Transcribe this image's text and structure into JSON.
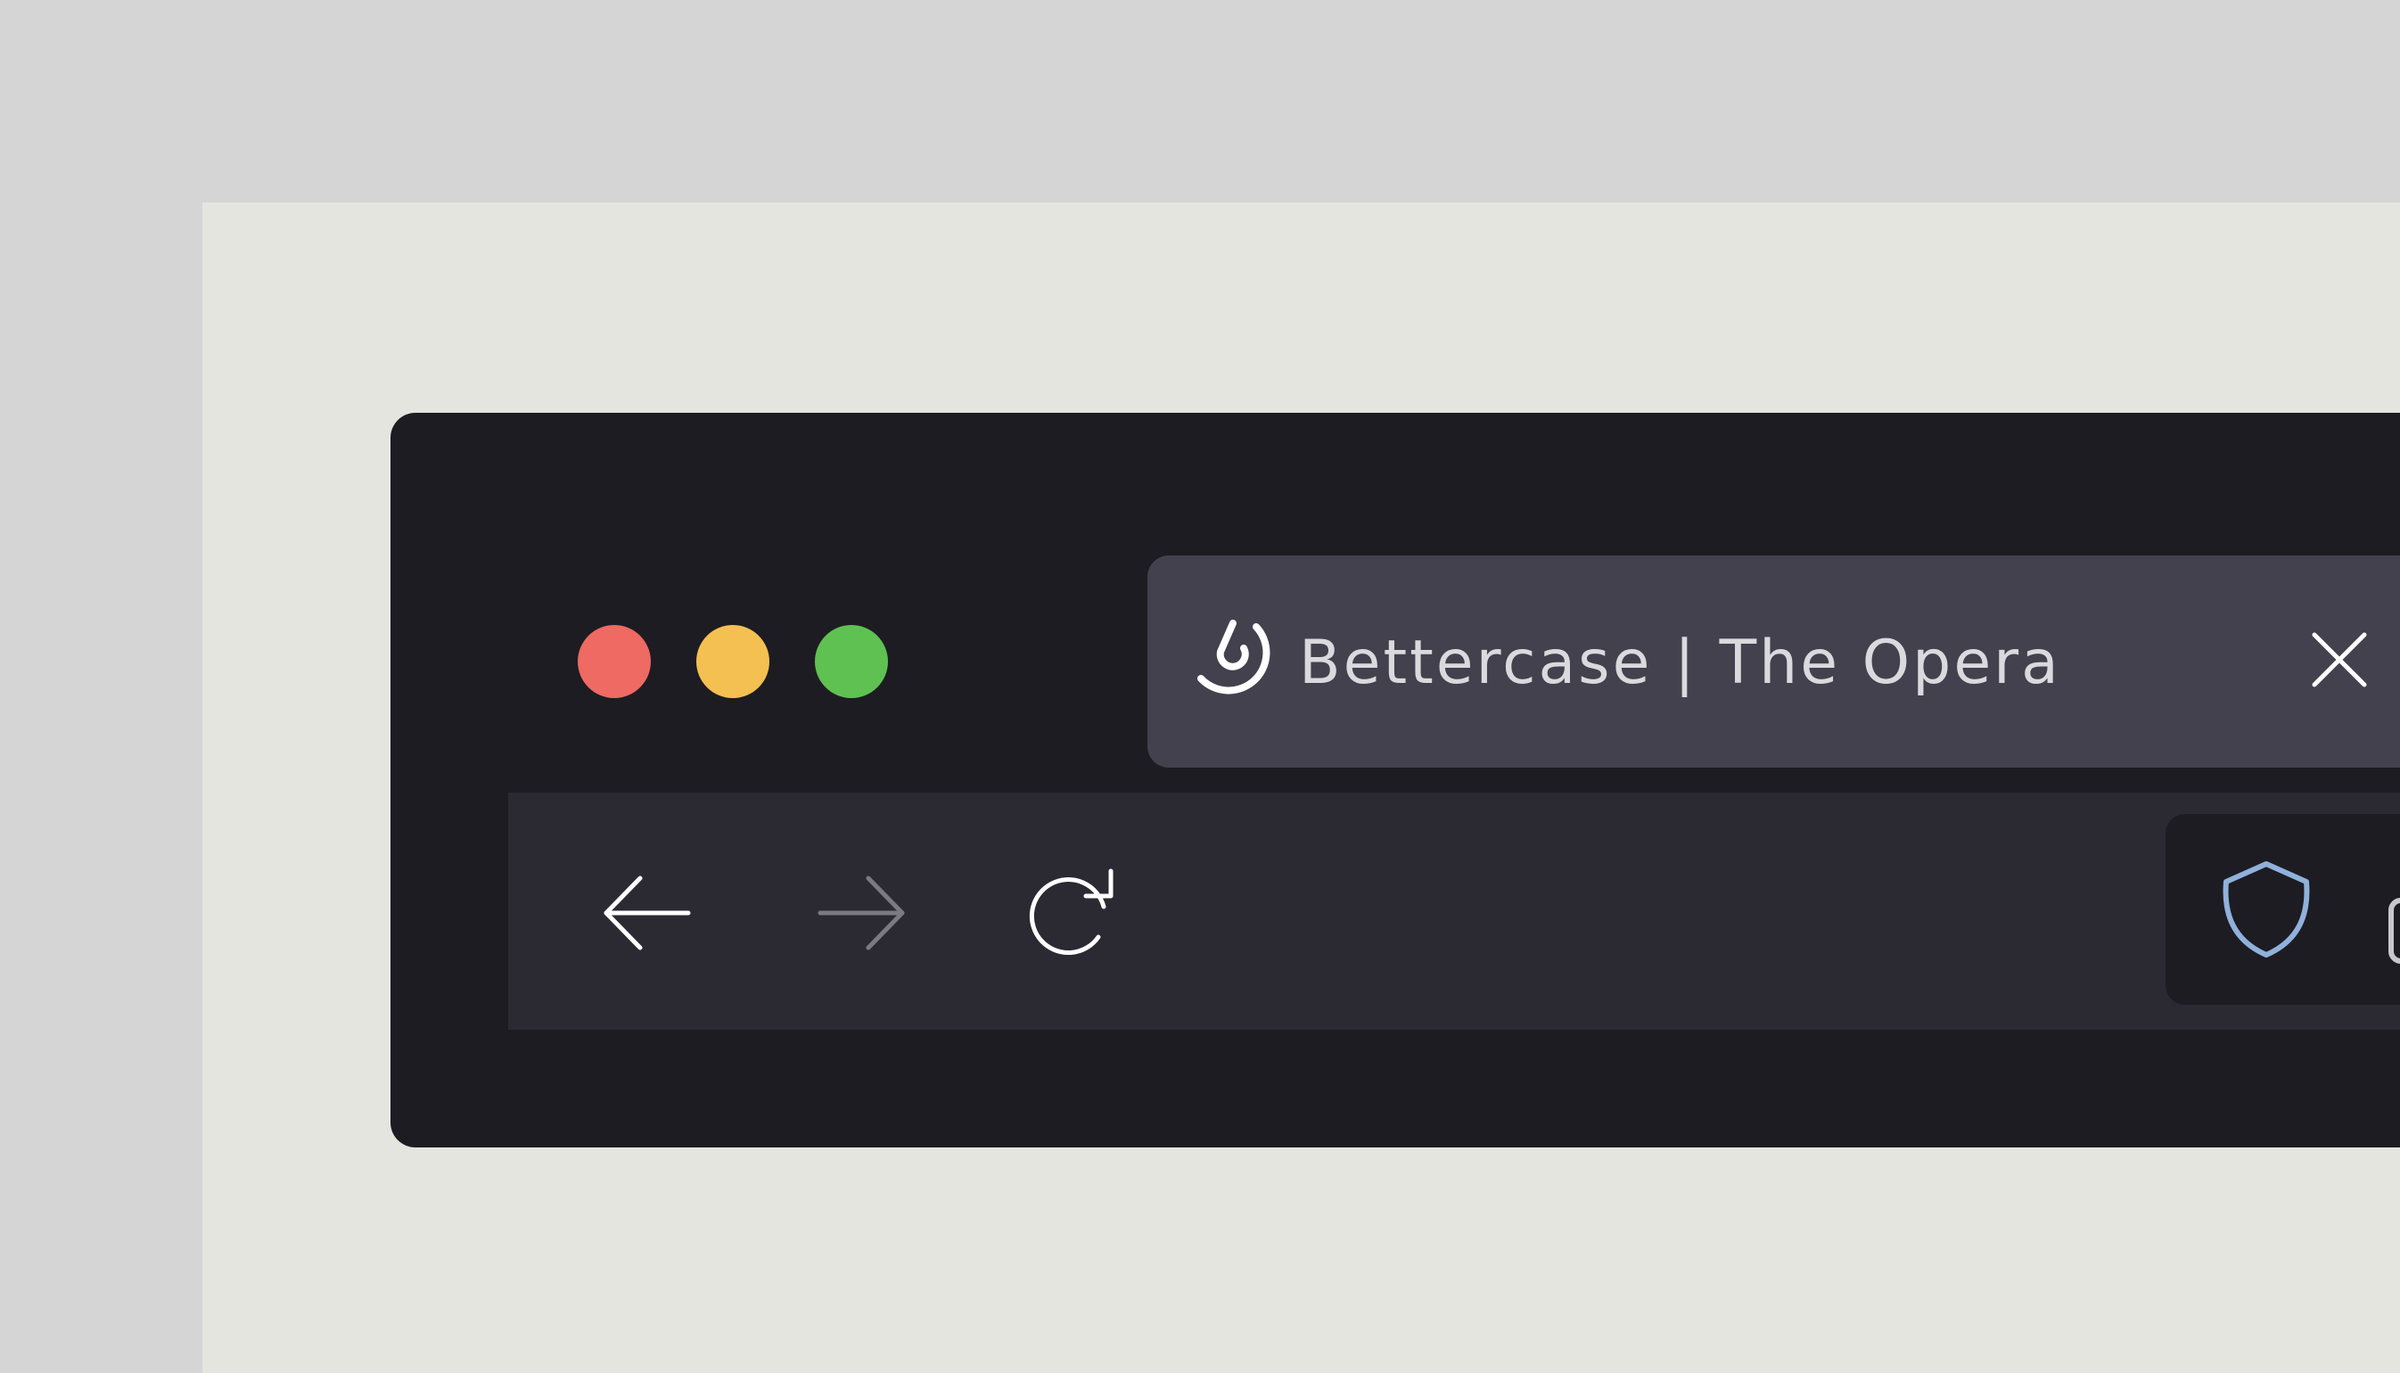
{
  "colors": {
    "page_bg": "#d5d5d5",
    "artboard_bg": "#e4e5de",
    "window_bg": "#1d1c22",
    "tab_bg": "#43414d",
    "toolbar_bg": "#2b2a33",
    "close_light": "#ee6a62",
    "minimize_light": "#f5c052",
    "maximize_light": "#5fc152",
    "shield_accent": "#8fb1dc",
    "forward_disabled": "#7a7a80"
  },
  "window_controls": {
    "close": "close-window-button",
    "minimize": "minimize-window-button",
    "maximize": "maximize-window-button"
  },
  "tab": {
    "title": "Bettercase | The Opera",
    "favicon": "bettercase-logo-icon",
    "close_icon": "close-icon"
  },
  "toolbar": {
    "back_icon": "arrow-left-icon",
    "forward_icon": "arrow-right-icon",
    "forward_enabled": false,
    "reload_icon": "reload-icon"
  },
  "extensions": {
    "shield_icon": "shield-icon"
  }
}
